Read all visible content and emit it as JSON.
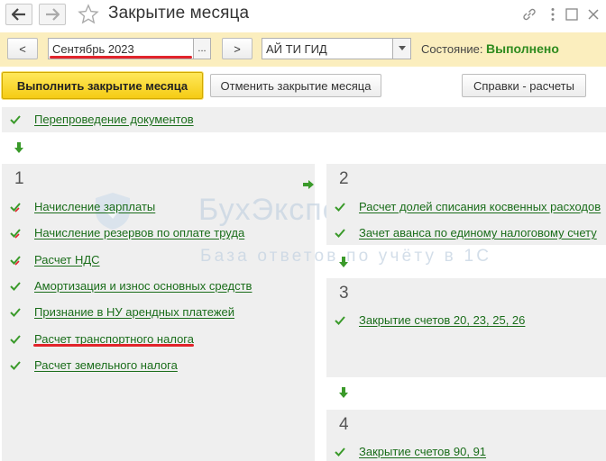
{
  "window": {
    "title": "Закрытие месяца",
    "back_icon": "arrow-left-icon",
    "forward_icon": "arrow-right-icon",
    "favorite_icon": "star-icon",
    "link_icon": "link-icon",
    "menu_icon": "more-vertical-icon",
    "maximize_icon": "maximize-icon",
    "close_icon": "close-icon"
  },
  "period": {
    "prev_label": "<",
    "value": "Сентябрь 2023",
    "select_label": "...",
    "next_label": ">"
  },
  "organization": {
    "value": "АЙ ТИ ГИД",
    "dropdown_icon": "triangle-down-icon"
  },
  "status": {
    "label": "Состояние:",
    "value": "Выполнено"
  },
  "actions": {
    "run_label": "Выполнить закрытие месяца",
    "cancel_label": "Отменить закрытие месяца",
    "reports_label": "Справки - расчеты"
  },
  "pre_step": {
    "items": [
      {
        "label": "Перепроведение документов",
        "status": "done"
      }
    ]
  },
  "steps": [
    {
      "number": "1",
      "items": [
        {
          "label": "Начисление зарплаты",
          "status": "done-warning"
        },
        {
          "label": "Начисление резервов по оплате труда",
          "status": "done-warning"
        },
        {
          "label": "Расчет НДС",
          "status": "done-warning"
        },
        {
          "label": "Амортизация и износ основных средств",
          "status": "done"
        },
        {
          "label": "Признание в НУ арендных платежей",
          "status": "done"
        },
        {
          "label": "Расчет транспортного налога",
          "status": "done"
        },
        {
          "label": "Расчет земельного налога",
          "status": "done"
        }
      ]
    },
    {
      "number": "2",
      "items": [
        {
          "label": "Расчет долей списания косвенных расходов",
          "status": "done"
        },
        {
          "label": "Зачет аванса по единому налоговому счету",
          "status": "done"
        }
      ]
    },
    {
      "number": "3",
      "items": [
        {
          "label": "Закрытие счетов 20, 23, 25, 26",
          "status": "done"
        }
      ]
    },
    {
      "number": "4",
      "items": [
        {
          "label": "Закрытие счетов 90, 91",
          "status": "done"
        }
      ]
    }
  ],
  "watermark": {
    "title": "БухЭксперт",
    "subtitle": "База ответов по учёту в 1С"
  },
  "colors": {
    "accent_yellow": "#f5cc14",
    "toolbar_bg": "#fbeebe",
    "success_green": "#2e8b1e",
    "link_green": "#1a6d1a",
    "highlight_red": "#e2242b"
  }
}
